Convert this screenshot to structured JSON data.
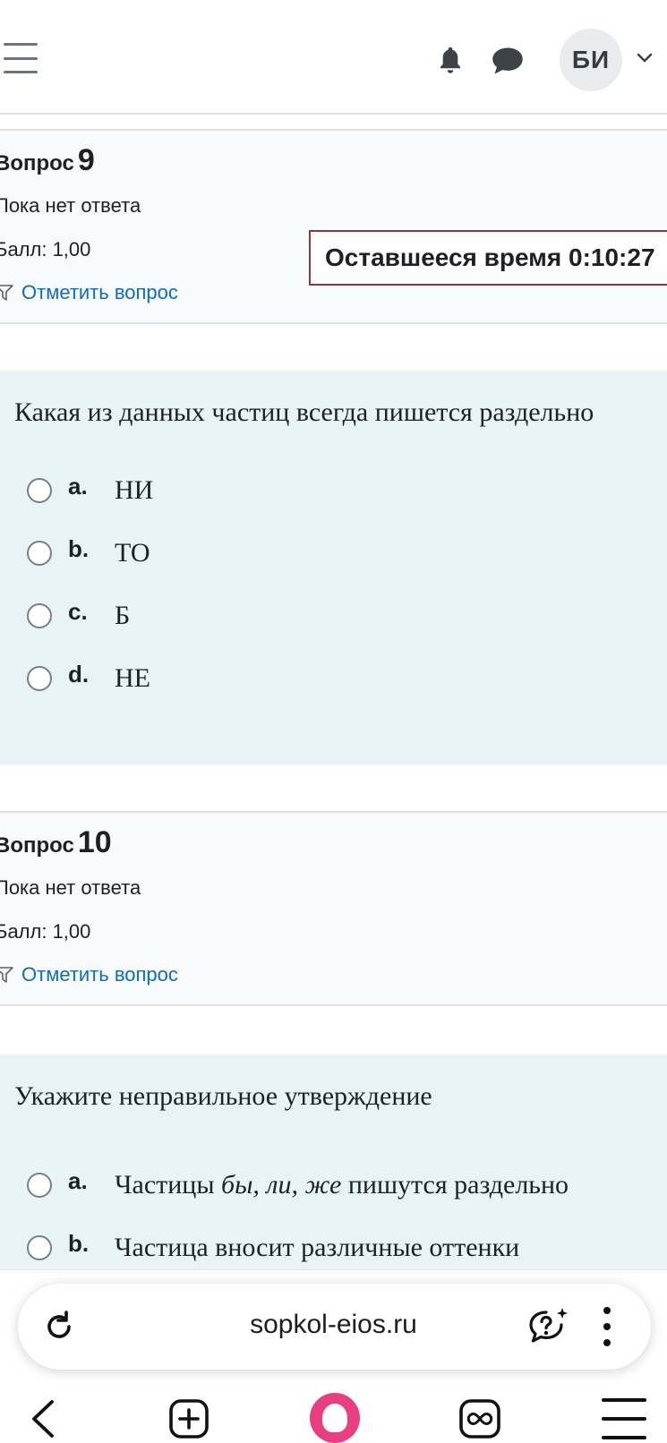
{
  "navbar": {
    "avatar_initials": "БИ"
  },
  "timer": {
    "label": "Оставшееся время 0:10:27"
  },
  "questions": [
    {
      "title_prefix": "Вопрос",
      "number": "9",
      "state": "Пока нет ответа",
      "grade": "Балл: 1,00",
      "flag_label": "Отметить вопрос",
      "text": "Какая из данных частиц всегда пишется раздельно",
      "answers": [
        {
          "letter": "a.",
          "text": "НИ"
        },
        {
          "letter": "b.",
          "text": "ТО"
        },
        {
          "letter": "c.",
          "text": "Б"
        },
        {
          "letter": "d.",
          "text": "НЕ"
        }
      ]
    },
    {
      "title_prefix": "Вопрос",
      "number": "10",
      "state": "Пока нет ответа",
      "grade": "Балл: 1,00",
      "flag_label": "Отметить вопрос",
      "text": "Укажите неправильное утверждение",
      "answers": [
        {
          "letter": "a.",
          "text_before": "Частицы ",
          "text_italic": "бы, ли, же",
          "text_after": " пишутся раздельно"
        },
        {
          "letter": "b.",
          "text": "Частица вносит различные оттенки"
        }
      ]
    }
  ],
  "browser": {
    "url": "sopkol-eios.ru"
  },
  "colors": {
    "link": "#0f6cbf",
    "formulation_bg": "#e7f3f5",
    "info_bg": "#f8f9fa",
    "timer_border": "#8b3a3a",
    "alice": "#e83f82"
  },
  "icons": [
    "hamburger-icon",
    "bell-icon",
    "chat-icon",
    "chevron-down-icon",
    "flag-icon",
    "reload-icon",
    "help-ai-icon",
    "kebab-icon",
    "back-icon",
    "new-tab-icon",
    "alice-icon",
    "tabs-icon",
    "menu-icon"
  ]
}
